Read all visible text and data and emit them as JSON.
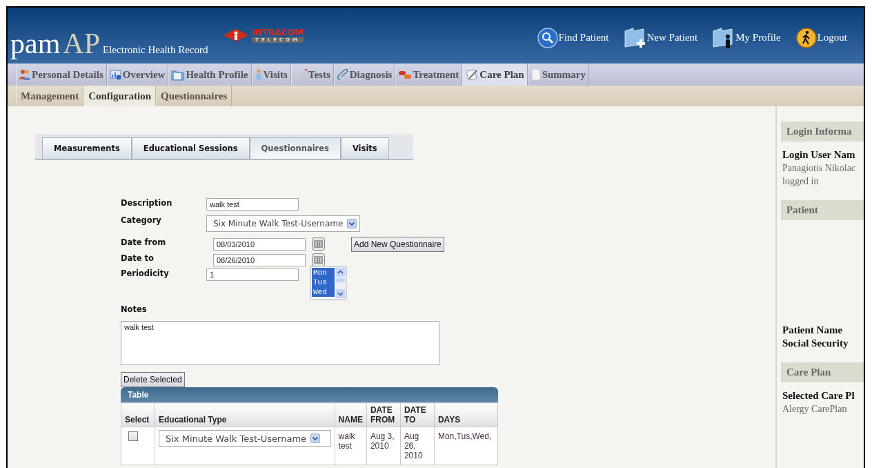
{
  "header": {
    "brand_main": "pam",
    "brand_accent": "AP",
    "subtitle": "Electronic Health Record",
    "partner_logo": {
      "name": "INTRACOM",
      "sub": "TELECOM"
    },
    "links": [
      {
        "kind": "search",
        "label": "Find Patient"
      },
      {
        "kind": "new",
        "label": "New Patient"
      },
      {
        "kind": "profile",
        "label": "My Profile"
      },
      {
        "kind": "logout",
        "label": "Logout"
      }
    ]
  },
  "nav": [
    {
      "kind": "people",
      "label": "Personal Details",
      "selected": false
    },
    {
      "kind": "overview",
      "label": "Overview",
      "selected": false
    },
    {
      "kind": "folder",
      "label": "Health Profile",
      "selected": false
    },
    {
      "kind": "person",
      "label": "Visits",
      "selected": false
    },
    {
      "kind": "pencil",
      "label": "Tests",
      "selected": false
    },
    {
      "kind": "clip",
      "label": "Diagnosis",
      "selected": false
    },
    {
      "kind": "pills",
      "label": "Treatment",
      "selected": false
    },
    {
      "kind": "notepad",
      "label": "Care Plan",
      "selected": true
    },
    {
      "kind": "page",
      "label": "Summary",
      "selected": false
    }
  ],
  "subnav": [
    {
      "label": "Management",
      "selected": false
    },
    {
      "label": "Configuration",
      "selected": true
    },
    {
      "label": "Questionnaires",
      "selected": false
    }
  ],
  "tabs": [
    {
      "label": "Measurements",
      "selected": false
    },
    {
      "label": "Educational Sessions",
      "selected": false
    },
    {
      "label": "Questionnaires",
      "selected": true
    },
    {
      "label": "Visits",
      "selected": false
    }
  ],
  "form": {
    "description": {
      "label": "Description",
      "value": "walk test"
    },
    "category": {
      "label": "Category",
      "value": "Six Minute Walk Test-Username"
    },
    "date_from": {
      "label": "Date from",
      "value": "08/03/2010"
    },
    "date_to": {
      "label": "Date to",
      "value": "08/26/2010"
    },
    "periodicity": {
      "label": "Periodicity",
      "value": "1"
    },
    "days": [
      {
        "label": "Mon",
        "selected": true
      },
      {
        "label": "Tus",
        "selected": true
      },
      {
        "label": "Wed",
        "selected": true
      }
    ],
    "notes": {
      "label": "Notes",
      "value": "walk test"
    },
    "add_button": "Add New Questionnaire",
    "delete_button": "Delete Selected"
  },
  "table": {
    "title": "Table",
    "columns": [
      "Select",
      "Educational Type",
      "NAME",
      "DATE FROM",
      "DATE TO",
      "DAYS"
    ],
    "rows": [
      {
        "checked": false,
        "type": "Six Minute Walk Test-Username",
        "name": "walk test",
        "date_from": "Aug 3, 2010",
        "date_to": "Aug 26, 2010",
        "days": "Mon,Tus,Wed,"
      }
    ]
  },
  "sidebar": {
    "sections": [
      {
        "title": "Login Informa",
        "items": [
          {
            "kind": "label",
            "text": "Login User Nam"
          },
          {
            "kind": "value",
            "text": "Panagiotis Nikolac"
          },
          {
            "kind": "value",
            "text": "logged in"
          }
        ]
      },
      {
        "title": "Patient",
        "items": [
          {
            "kind": "spacer"
          },
          {
            "kind": "label",
            "text": "Patient Name"
          },
          {
            "kind": "label",
            "text": "Social Security"
          }
        ]
      },
      {
        "title": "Care Plan",
        "items": [
          {
            "kind": "label",
            "text": "Selected Care Pl"
          },
          {
            "kind": "value",
            "text": "Alergy CarePlan"
          }
        ]
      }
    ]
  }
}
